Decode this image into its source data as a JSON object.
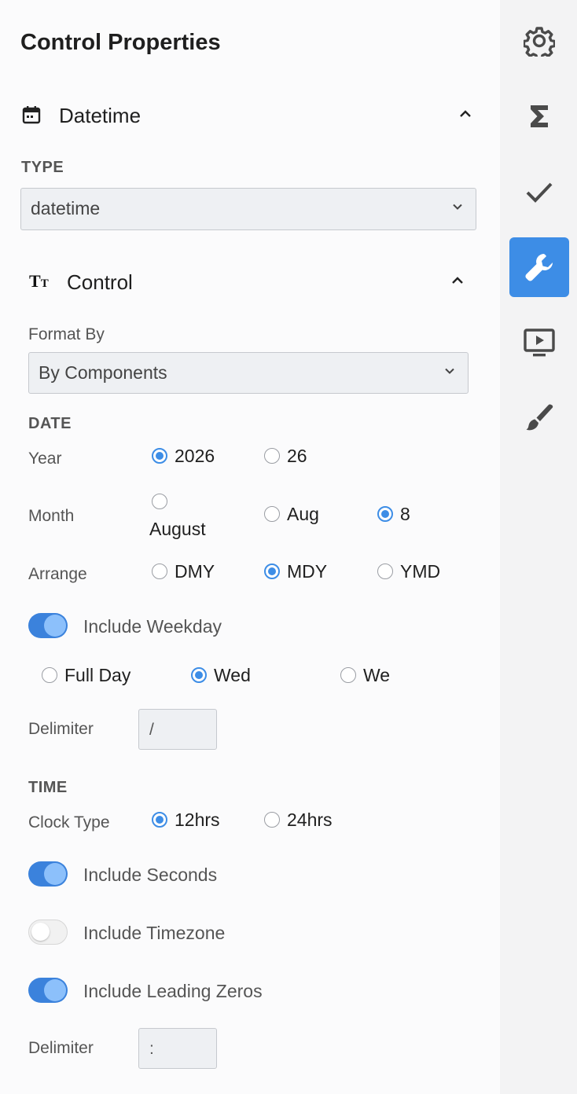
{
  "panel": {
    "title": "Control Properties"
  },
  "datetime_section": {
    "label": "Datetime",
    "icon": "calendar-icon"
  },
  "type_field": {
    "label": "TYPE",
    "value": "datetime"
  },
  "control_section": {
    "label": "Control",
    "icon": "text-size-icon"
  },
  "format_by": {
    "label": "Format By",
    "value": "By Components"
  },
  "date": {
    "heading": "DATE",
    "year": {
      "label": "Year",
      "options": [
        "2026",
        "26"
      ],
      "selected": "2026"
    },
    "month": {
      "label": "Month",
      "options": [
        "August",
        "Aug",
        "8"
      ],
      "selected": "8"
    },
    "arrange": {
      "label": "Arrange",
      "options": [
        "DMY",
        "MDY",
        "YMD"
      ],
      "selected": "MDY"
    },
    "include_weekday": {
      "label": "Include Weekday",
      "on": true
    },
    "weekday": {
      "options": [
        "Full Day",
        "Wed",
        "We"
      ],
      "selected": "Wed"
    },
    "delimiter": {
      "label": "Delimiter",
      "value": "/"
    }
  },
  "time": {
    "heading": "TIME",
    "clock_type": {
      "label": "Clock Type",
      "options": [
        "12hrs",
        "24hrs"
      ],
      "selected": "12hrs"
    },
    "include_seconds": {
      "label": "Include Seconds",
      "on": true
    },
    "include_timezone": {
      "label": "Include Timezone",
      "on": false
    },
    "include_leading_zeros": {
      "label": "Include Leading Zeros",
      "on": true
    },
    "delimiter": {
      "label": "Delimiter",
      "value": ":"
    }
  },
  "rail": {
    "icons": [
      "gear-icon",
      "sigma-icon",
      "check-icon",
      "wrench-icon",
      "play-screen-icon",
      "brush-icon"
    ],
    "active": "wrench-icon"
  },
  "colors": {
    "accent": "#3d8de6",
    "toggle_on": "#3b82dc",
    "rail_bg": "#f3f3f4"
  }
}
